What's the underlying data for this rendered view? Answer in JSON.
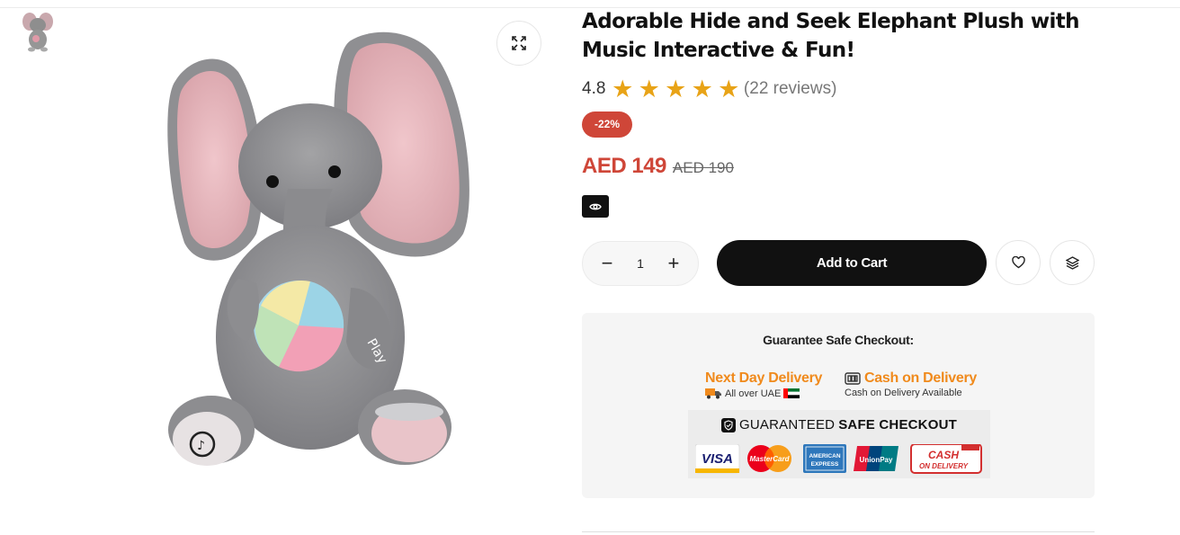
{
  "product": {
    "title": "Adorable Hide and Seek Elephant Plush with Music Interactive & Fun!",
    "rating": "4.8",
    "stars": 5,
    "reviews": "(22 reviews)",
    "discount": "-22%",
    "price": "AED 149",
    "old_price": "AED 190",
    "image_text": "Play"
  },
  "actions": {
    "quantity": "1",
    "decrease": "−",
    "increase": "+",
    "add_to_cart": "Add to Cart",
    "wishlist_icon": "heart-icon",
    "compare_icon": "layers-icon",
    "zoom_icon": "expand-icon",
    "view_icon": "eye-icon"
  },
  "guarantee": {
    "title": "Guarantee Safe Checkout:",
    "next_day_title": "Next Day Delivery",
    "next_day_sub": "All over UAE",
    "cod_title": "Cash on Delivery",
    "cod_sub": "Cash on Delivery Available",
    "secure_prefix": "GUARANTEED",
    "secure_bold": "SAFE CHECKOUT",
    "payments": [
      "VISA",
      "MasterCard",
      "AMERICAN EXPRESS",
      "UnionPay",
      "CASH ON DELIVERY"
    ]
  },
  "colors": {
    "accent_red": "#cf4638",
    "star": "#e8a317",
    "orange": "#f08a1c",
    "dark": "#111111"
  }
}
